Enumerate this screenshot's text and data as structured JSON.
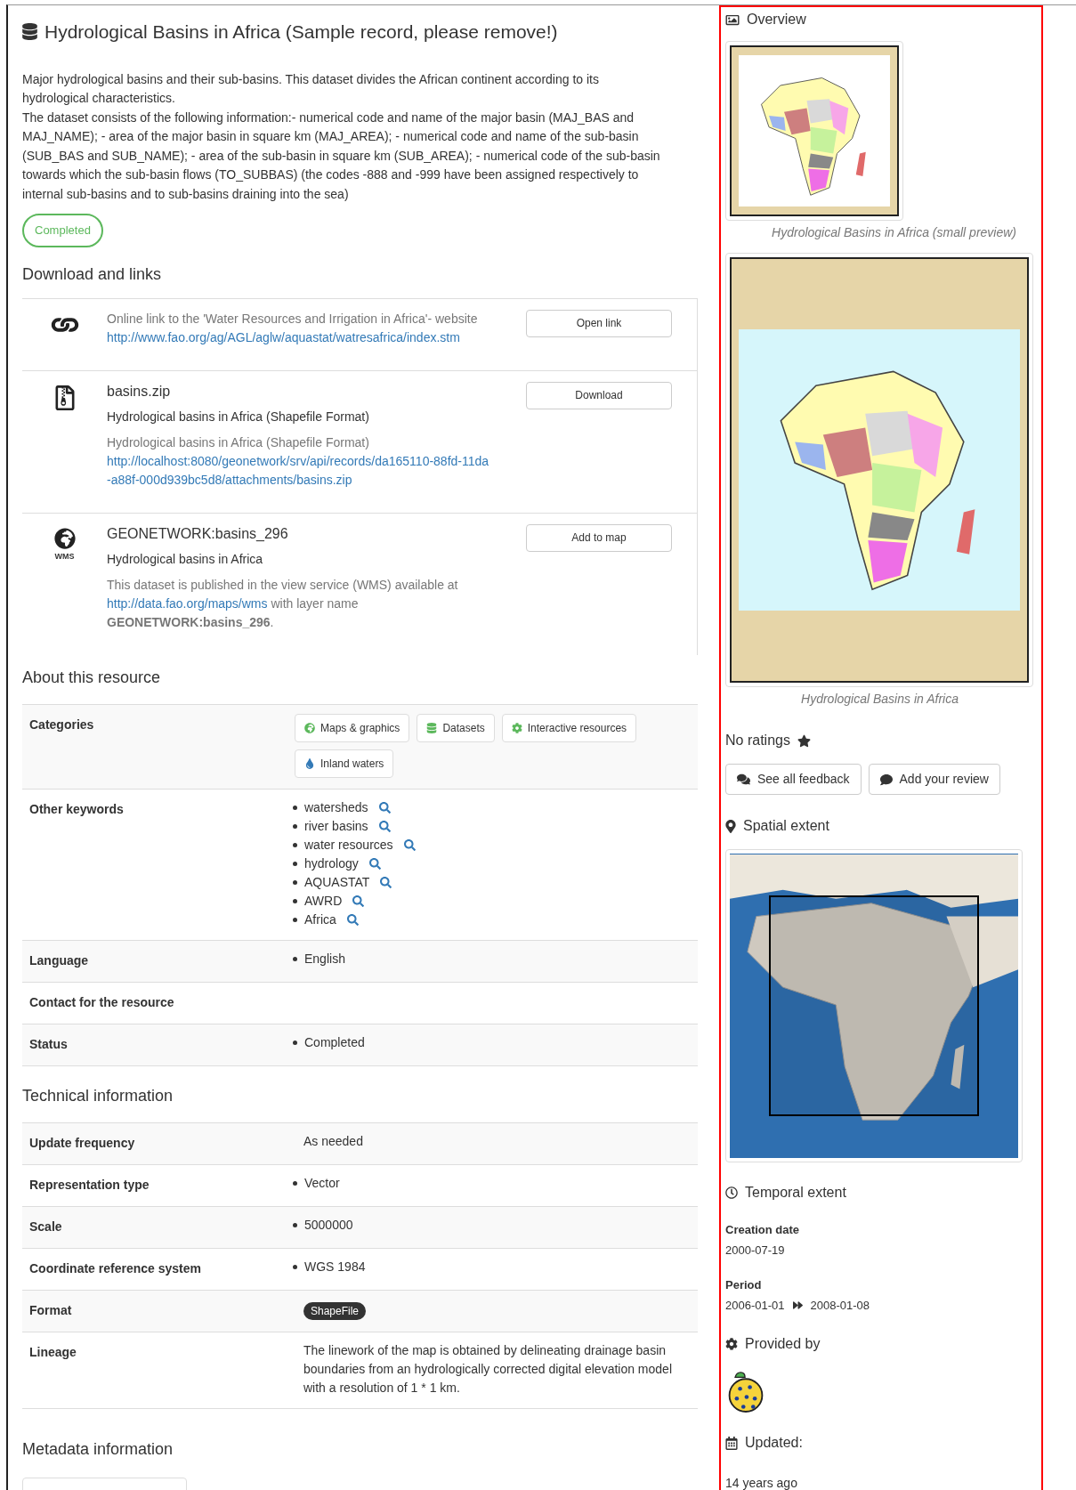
{
  "title": "Hydrological Basins in Africa (Sample record, please remove!)",
  "description": [
    "Major hydrological basins and their sub-basins. This dataset divides the African continent according to its hydrological characteristics.",
    "The dataset consists of the following information:- numerical code and name of the major basin (MAJ_BAS and MAJ_NAME); - area of the major basin in square km (MAJ_AREA); - numerical code and name of the sub-basin (SUB_BAS and SUB_NAME); - area of the sub-basin in square km (SUB_AREA); - numerical code of the sub-basin towards which the sub-basin flows (TO_SUBBAS) (the codes -888 and -999 have been assigned respectively to internal sub-basins and to sub-basins draining into the sea)"
  ],
  "status_badge": "Completed",
  "downloads": {
    "heading": "Download and links",
    "items": [
      {
        "kind": "link",
        "description": "Online link to the 'Water Resources and Irrigation in Africa'- website",
        "url": "http://www.fao.org/ag/AGL/aglw/aquastat/watresafrica/index.stm",
        "button": "Open link"
      },
      {
        "kind": "file",
        "name": "basins.zip",
        "subtitle": "Hydrological basins in Africa (Shapefile Format)",
        "description": "Hydrological basins in Africa (Shapefile Format)",
        "url": "http://localhost:8080/geonetwork/srv/api/records/da165110-88fd-11da-a88f-000d939bc5d8/attachments/basins.zip",
        "button": "Download"
      },
      {
        "kind": "wms",
        "icon_label": "WMS",
        "name": "GEONETWORK:basins_296",
        "subtitle": "Hydrological basins in Africa",
        "description": "This dataset is published in the view service (WMS) available at",
        "url": "http://data.fao.org/maps/wms",
        "description_after": "with layer name **GEONETWORK:basins_296**.",
        "button": "Add to map"
      }
    ]
  },
  "about": {
    "heading": "About this resource",
    "rows": [
      {
        "kind": "tags",
        "label": "Categories",
        "values": [
          "Maps & graphics",
          "Datasets",
          "Interactive resources",
          "Inland waters"
        ]
      },
      {
        "kind": "keywords",
        "label": "Other keywords",
        "values": [
          "watersheds",
          "river basins",
          "water resources",
          "hydrology",
          "AQUASTAT",
          "AWRD",
          "Africa"
        ]
      },
      {
        "kind": "list",
        "label": "Language",
        "values": [
          "English"
        ]
      },
      {
        "kind": "list",
        "label": "Contact for the resource",
        "values": []
      },
      {
        "kind": "list",
        "label": "Status",
        "values": [
          "Completed"
        ]
      }
    ]
  },
  "technical": {
    "heading": "Technical information",
    "rows": [
      {
        "kind": "text",
        "label": "Update frequency",
        "values": [
          "As needed"
        ]
      },
      {
        "kind": "list",
        "label": "Representation type",
        "values": [
          "Vector"
        ]
      },
      {
        "kind": "list",
        "label": "Scale",
        "values": [
          "5000000"
        ]
      },
      {
        "kind": "list",
        "label": "Coordinate reference system",
        "values": [
          "WGS 1984"
        ]
      },
      {
        "kind": "pill",
        "label": "Format",
        "values": [
          "ShapeFile"
        ]
      },
      {
        "kind": "text",
        "label": "Lineage",
        "values": [
          "The linework of the map is obtained by delineating drainage basin boundaries from an hydrologically corrected digital elevation model with a resolution of 1 * 1 km."
        ]
      }
    ]
  },
  "metadata": {
    "heading": "Metadata information"
  },
  "sidebar": {
    "overview_heading": "Overview",
    "images": [
      {
        "kind": "small",
        "caption": "Hydrological Basins in Africa (small preview)"
      },
      {
        "kind": "large",
        "caption": "Hydrological Basins in Africa"
      }
    ],
    "ratings": "No ratings",
    "feedback_buttons": [
      "See all feedback",
      "Add your review"
    ],
    "spatial_heading": "Spatial extent",
    "temporal_heading": "Temporal extent",
    "creation_label": "Creation date",
    "creation_date": "2000-07-19",
    "period_label": "Period",
    "period_start": "2006-01-01",
    "period_end": "2008-01-08",
    "provided_heading": "Provided by",
    "updated_heading": "Updated:",
    "updated_value": "14 years ago"
  }
}
